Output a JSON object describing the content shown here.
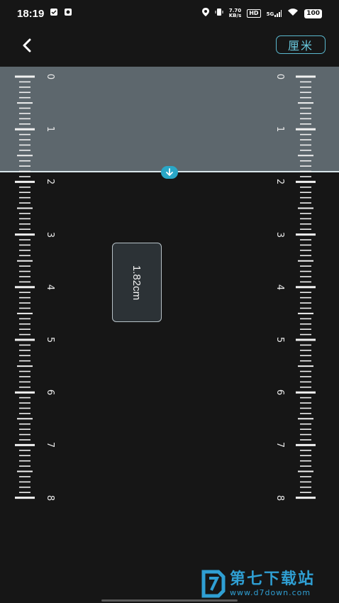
{
  "status_bar": {
    "time": "18:19",
    "speed_value": "7.70",
    "speed_unit": "KB/s",
    "hd_label": "HD",
    "network_label": "5G",
    "battery_level": "100"
  },
  "header": {
    "back_icon": "chevron-left-icon",
    "unit_label": "厘米"
  },
  "ruler": {
    "labels": [
      "0",
      "1",
      "2",
      "3",
      "4",
      "5",
      "6",
      "7",
      "8"
    ]
  },
  "measurement": {
    "value_label": "1.82cm",
    "value_cm": 1.82,
    "handle_icon": "arrow-down-icon"
  },
  "watermark": {
    "brand": "第七下载站",
    "url": "www.d7down.com"
  },
  "colors": {
    "background": "#161616",
    "band": "#5d676d",
    "accent": "#2aa7c7",
    "unit_text": "#68c7dc"
  }
}
